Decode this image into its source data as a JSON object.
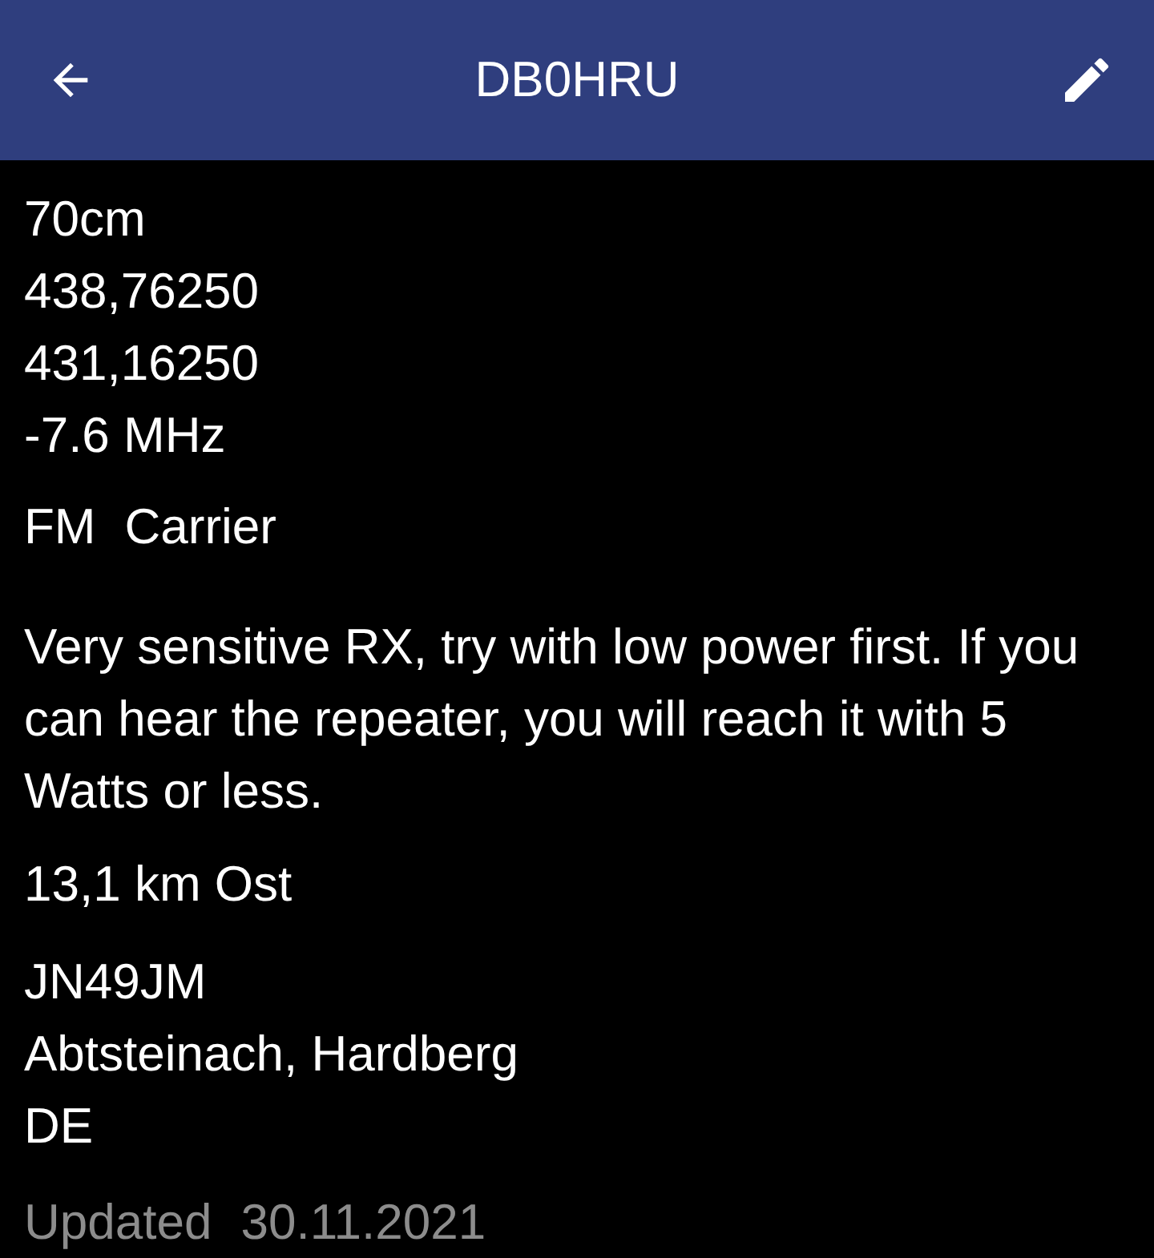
{
  "app_bar": {
    "title": "DB0HRU"
  },
  "band": "70cm",
  "frequencies": [
    "438,76250",
    "431,16250"
  ],
  "shift": "-7.6 MHz",
  "modes": [
    "FM",
    "Carrier"
  ],
  "remarks": "Very sensitive RX, try with low power first. If you can hear the repeater, you will reach it with 5 Watts or less.",
  "distance": "13,1 km Ost",
  "location": [
    "JN49JM",
    "Abtsteinach, Hardberg",
    "DE"
  ],
  "updated": {
    "label": "Updated",
    "date": "30.11.2021"
  }
}
